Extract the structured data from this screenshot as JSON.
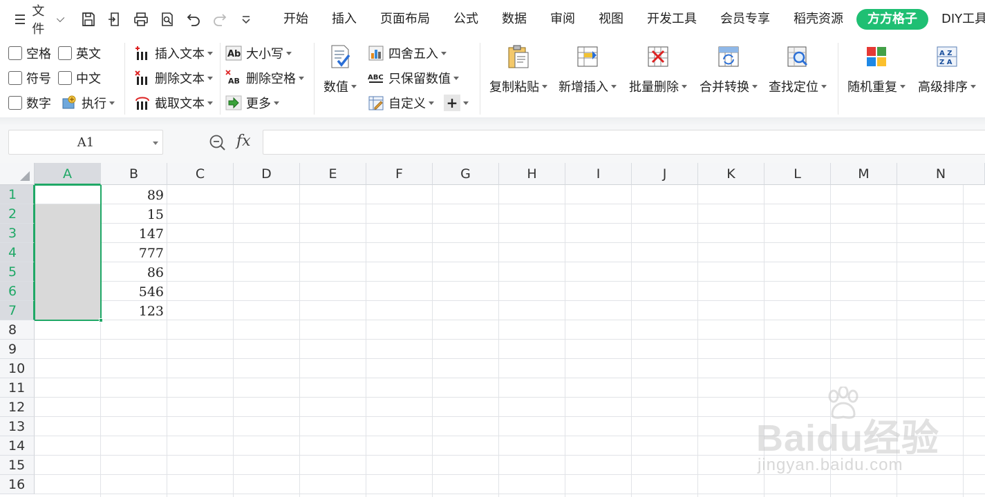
{
  "menubar": {
    "file_label": "文件",
    "tabs": [
      "开始",
      "插入",
      "页面布局",
      "公式",
      "数据",
      "审阅",
      "视图",
      "开发工具",
      "会员专享",
      "稻壳资源",
      "方方格子",
      "DIY工具箱"
    ],
    "active_tab": "方方格子"
  },
  "ribbon": {
    "checks": {
      "space": "空格",
      "english": "英文",
      "symbol": "符号",
      "chinese": "中文",
      "number": "数字"
    },
    "execute": "执行",
    "insert_text": "插入文本",
    "delete_text": "删除文本",
    "cut_text": "截取文本",
    "case": "大小写",
    "delete_space": "删除空格",
    "more": "更多",
    "numeric": "数值",
    "round": "四舍五入",
    "keep_numeric": "只保留数值",
    "custom": "自定义",
    "plus": "+",
    "copy_paste": "复制粘贴",
    "new_insert": "新增插入",
    "batch_delete": "批量删除",
    "merge_convert": "合并转换",
    "find_locate": "查找定位",
    "random_repeat": "随机重复",
    "advanced_sort": "高级排序"
  },
  "formula_bar": {
    "cell_ref": "A1",
    "fx": "fx",
    "formula": ""
  },
  "sheet": {
    "columns": [
      "A",
      "B",
      "C",
      "D",
      "E",
      "F",
      "G",
      "H",
      "I",
      "J",
      "K",
      "L",
      "M",
      "N"
    ],
    "rows": [
      "1",
      "2",
      "3",
      "4",
      "5",
      "6",
      "7",
      "8",
      "9",
      "10",
      "11",
      "12",
      "13",
      "14",
      "15",
      "16"
    ],
    "selected_column": "A",
    "column_b_values": [
      "89",
      "15",
      "147",
      "777",
      "86",
      "546",
      "123"
    ]
  },
  "watermark": {
    "brand": "Baidu经验",
    "url": "jingyan.baidu.com"
  },
  "colors": {
    "accent": "#1fbf73",
    "selection": "#1fa866",
    "selection_fill": "#d9d9d9"
  }
}
